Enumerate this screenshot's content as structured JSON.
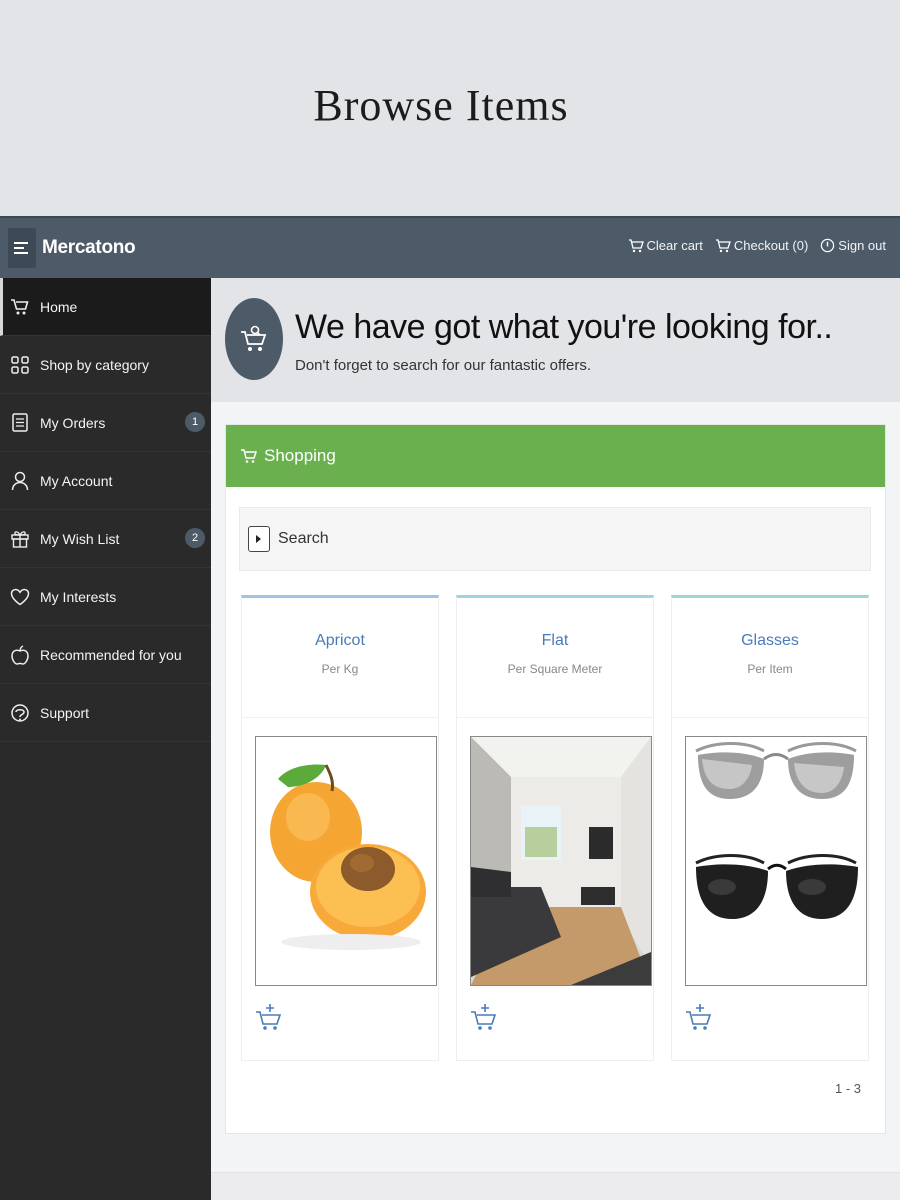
{
  "banner": {
    "title": "Browse Items"
  },
  "topbar": {
    "brand": "Mercatono",
    "actions": [
      {
        "label": "Clear cart",
        "icon": "cart-icon"
      },
      {
        "label": "Checkout (0)",
        "icon": "cart-icon"
      },
      {
        "label": "Sign out",
        "icon": "power-icon"
      }
    ]
  },
  "sidebar": {
    "items": [
      {
        "label": "Home",
        "icon": "cart-icon",
        "active": true
      },
      {
        "label": "Shop by category",
        "icon": "grid-icon"
      },
      {
        "label": "My Orders",
        "icon": "document-icon",
        "badge": "1"
      },
      {
        "label": "My Account",
        "icon": "user-icon"
      },
      {
        "label": "My Wish List",
        "icon": "gift-icon",
        "badge": "2"
      },
      {
        "label": "My Interests",
        "icon": "heart-icon"
      },
      {
        "label": "Recommended for you",
        "icon": "apple-icon"
      },
      {
        "label": "Support",
        "icon": "support-icon"
      }
    ]
  },
  "hero": {
    "title": "We have got what you're looking for..",
    "subtitle": "Don't forget to search for our fantastic offers."
  },
  "shopping": {
    "title": "Shopping",
    "search_label": "Search",
    "products": [
      {
        "name": "Apricot",
        "unit": "Per Kg",
        "image": "apricot"
      },
      {
        "name": "Flat",
        "unit": "Per Square Meter",
        "image": "flat"
      },
      {
        "name": "Glasses",
        "unit": "Per Item",
        "image": "glasses"
      }
    ],
    "pagination": "1 - 3"
  },
  "colors": {
    "topbar": "#4d5b68",
    "sidebar": "#2a2a2a",
    "shopping_header": "#6ab04f",
    "product_name": "#4a7ab8"
  }
}
